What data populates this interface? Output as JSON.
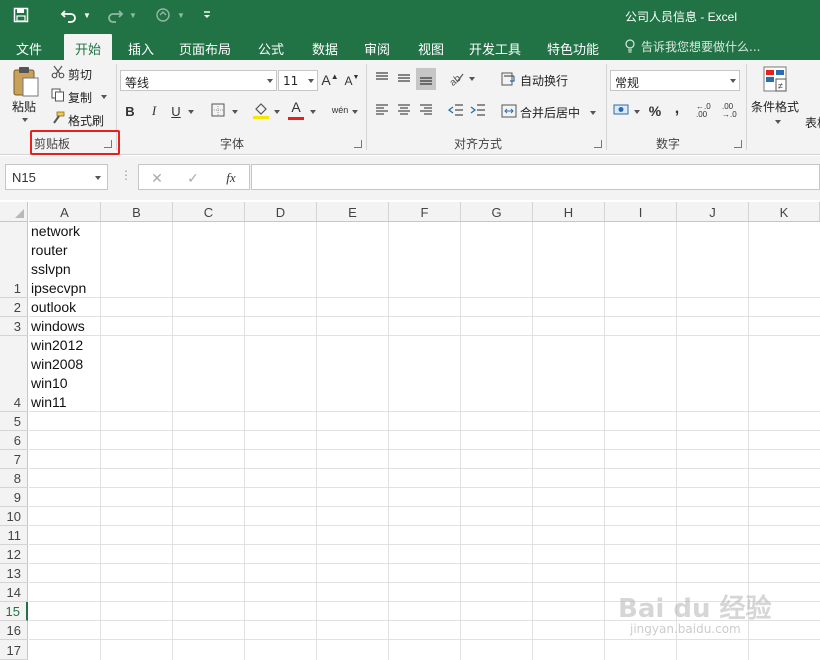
{
  "window": {
    "title": "公司人员信息 - Excel"
  },
  "quick_access": {
    "save_icon": "save-icon",
    "undo_icon": "undo-icon",
    "redo_icon": "redo-icon",
    "touch_icon": "touch-mode-icon",
    "customize_icon": "customize-qat-icon"
  },
  "tabs": [
    {
      "label": "文件"
    },
    {
      "label": "开始"
    },
    {
      "label": "插入"
    },
    {
      "label": "页面布局"
    },
    {
      "label": "公式"
    },
    {
      "label": "数据"
    },
    {
      "label": "审阅"
    },
    {
      "label": "视图"
    },
    {
      "label": "开发工具"
    },
    {
      "label": "特色功能"
    }
  ],
  "active_tab": "开始",
  "tell_me": "告诉我您想要做什么...",
  "ribbon": {
    "clipboard": {
      "paste": "粘贴",
      "cut": "剪切",
      "copy": "复制",
      "format_painter": "格式刷",
      "group_label": "剪贴板"
    },
    "font": {
      "font_name": "等线",
      "font_size": "11",
      "grow": "A",
      "shrink": "A",
      "bold": "B",
      "italic": "I",
      "underline": "U",
      "font_color_letter": "A",
      "phonetic": "wén",
      "group_label": "字体"
    },
    "alignment": {
      "wrap_text": "自动换行",
      "merge_center": "合并后居中",
      "group_label": "对齐方式"
    },
    "number": {
      "format": "常规",
      "percent": "%",
      "comma": ",",
      "increase_decimal": "←.0 .00",
      "decrease_decimal": ".00 →.0",
      "group_label": "数字"
    },
    "styles": {
      "conditional_formatting": "条件格式",
      "table_partial": "表格"
    }
  },
  "formula_bar": {
    "name_box": "N15",
    "fx": "fx",
    "formula": ""
  },
  "grid": {
    "columns": [
      "A",
      "B",
      "C",
      "D",
      "E",
      "F",
      "G",
      "H",
      "I",
      "J",
      "K"
    ],
    "rows": [
      "1",
      "2",
      "3",
      "4",
      "5",
      "6",
      "7",
      "8",
      "9",
      "10",
      "11",
      "12",
      "13",
      "14",
      "15",
      "16",
      "17"
    ],
    "active_row": "15",
    "cells": {
      "A1": "network\nrouter\nsslvpn\nipsecvpn",
      "A2": "outlook",
      "A3": "windows",
      "A4": "win2012\nwin2008\nwin10\nwin11"
    }
  },
  "watermark": {
    "main": "Bai du 经验",
    "sub": "jingyan.baidu.com"
  },
  "colors": {
    "excel_green": "#217346",
    "highlight_red": "#e8201c"
  }
}
